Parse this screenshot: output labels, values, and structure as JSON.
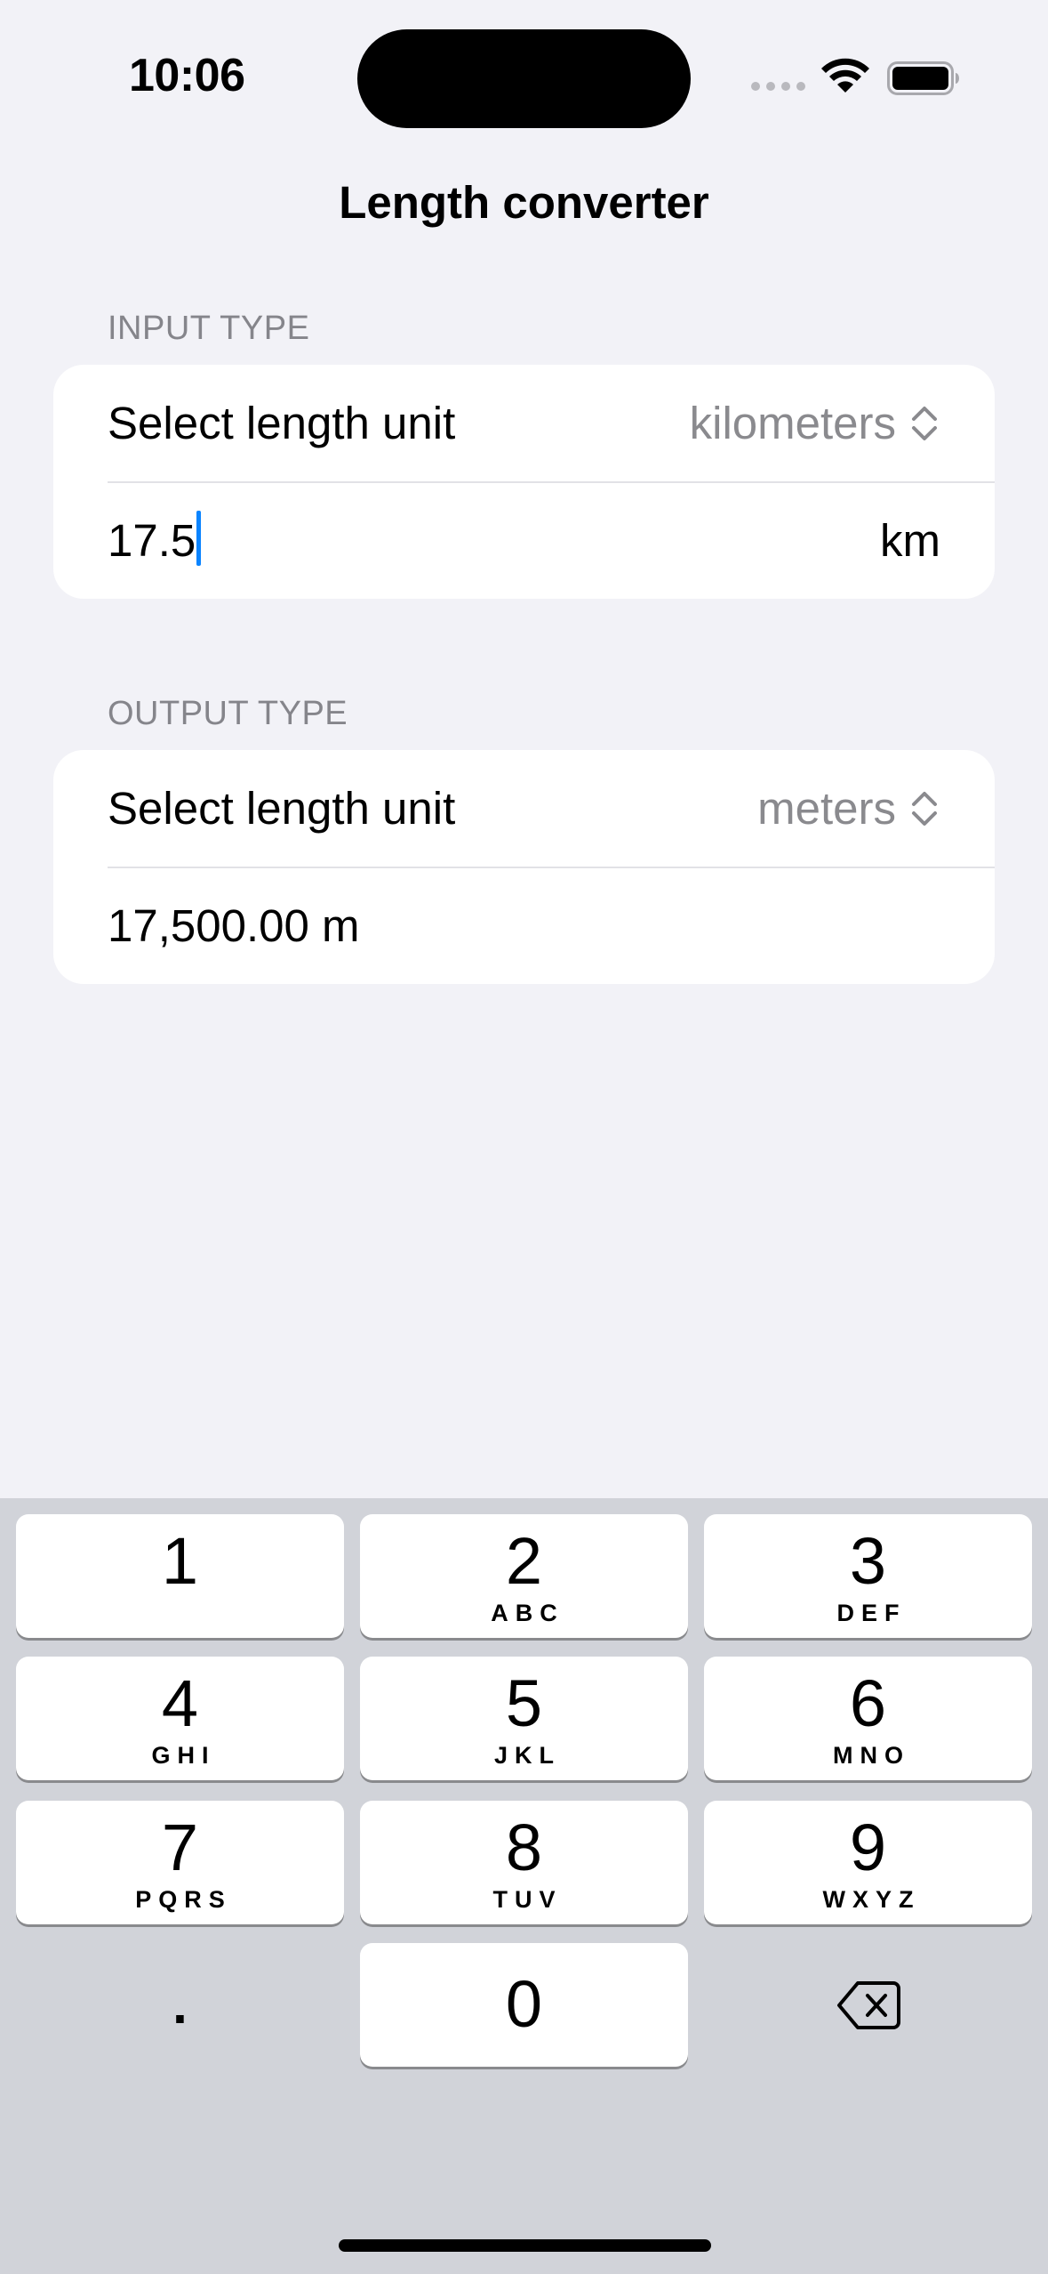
{
  "status_bar": {
    "time": "10:06"
  },
  "nav": {
    "title": "Length converter"
  },
  "input_section": {
    "header": "INPUT TYPE",
    "picker_label": "Select length unit",
    "picker_value": "kilometers",
    "input_value": "17.5",
    "unit_symbol": "km"
  },
  "output_section": {
    "header": "OUTPUT TYPE",
    "picker_label": "Select length unit",
    "picker_value": "meters",
    "result": "17,500.00 m"
  },
  "keyboard": {
    "keys": [
      {
        "digit": "1",
        "letters": ""
      },
      {
        "digit": "2",
        "letters": "ABC"
      },
      {
        "digit": "3",
        "letters": "DEF"
      },
      {
        "digit": "4",
        "letters": "GHI"
      },
      {
        "digit": "5",
        "letters": "JKL"
      },
      {
        "digit": "6",
        "letters": "MNO"
      },
      {
        "digit": "7",
        "letters": "PQRS"
      },
      {
        "digit": "8",
        "letters": "TUV"
      },
      {
        "digit": "9",
        "letters": "WXYZ"
      },
      {
        "digit": "0",
        "letters": ""
      }
    ],
    "decimal": ".",
    "delete_icon": "delete-backward-icon"
  },
  "colors": {
    "background": "#F2F2F7",
    "accent": "#0A84FF",
    "secondary_text": "#8A8A8E",
    "keyboard_bg": "#D1D3D9"
  }
}
